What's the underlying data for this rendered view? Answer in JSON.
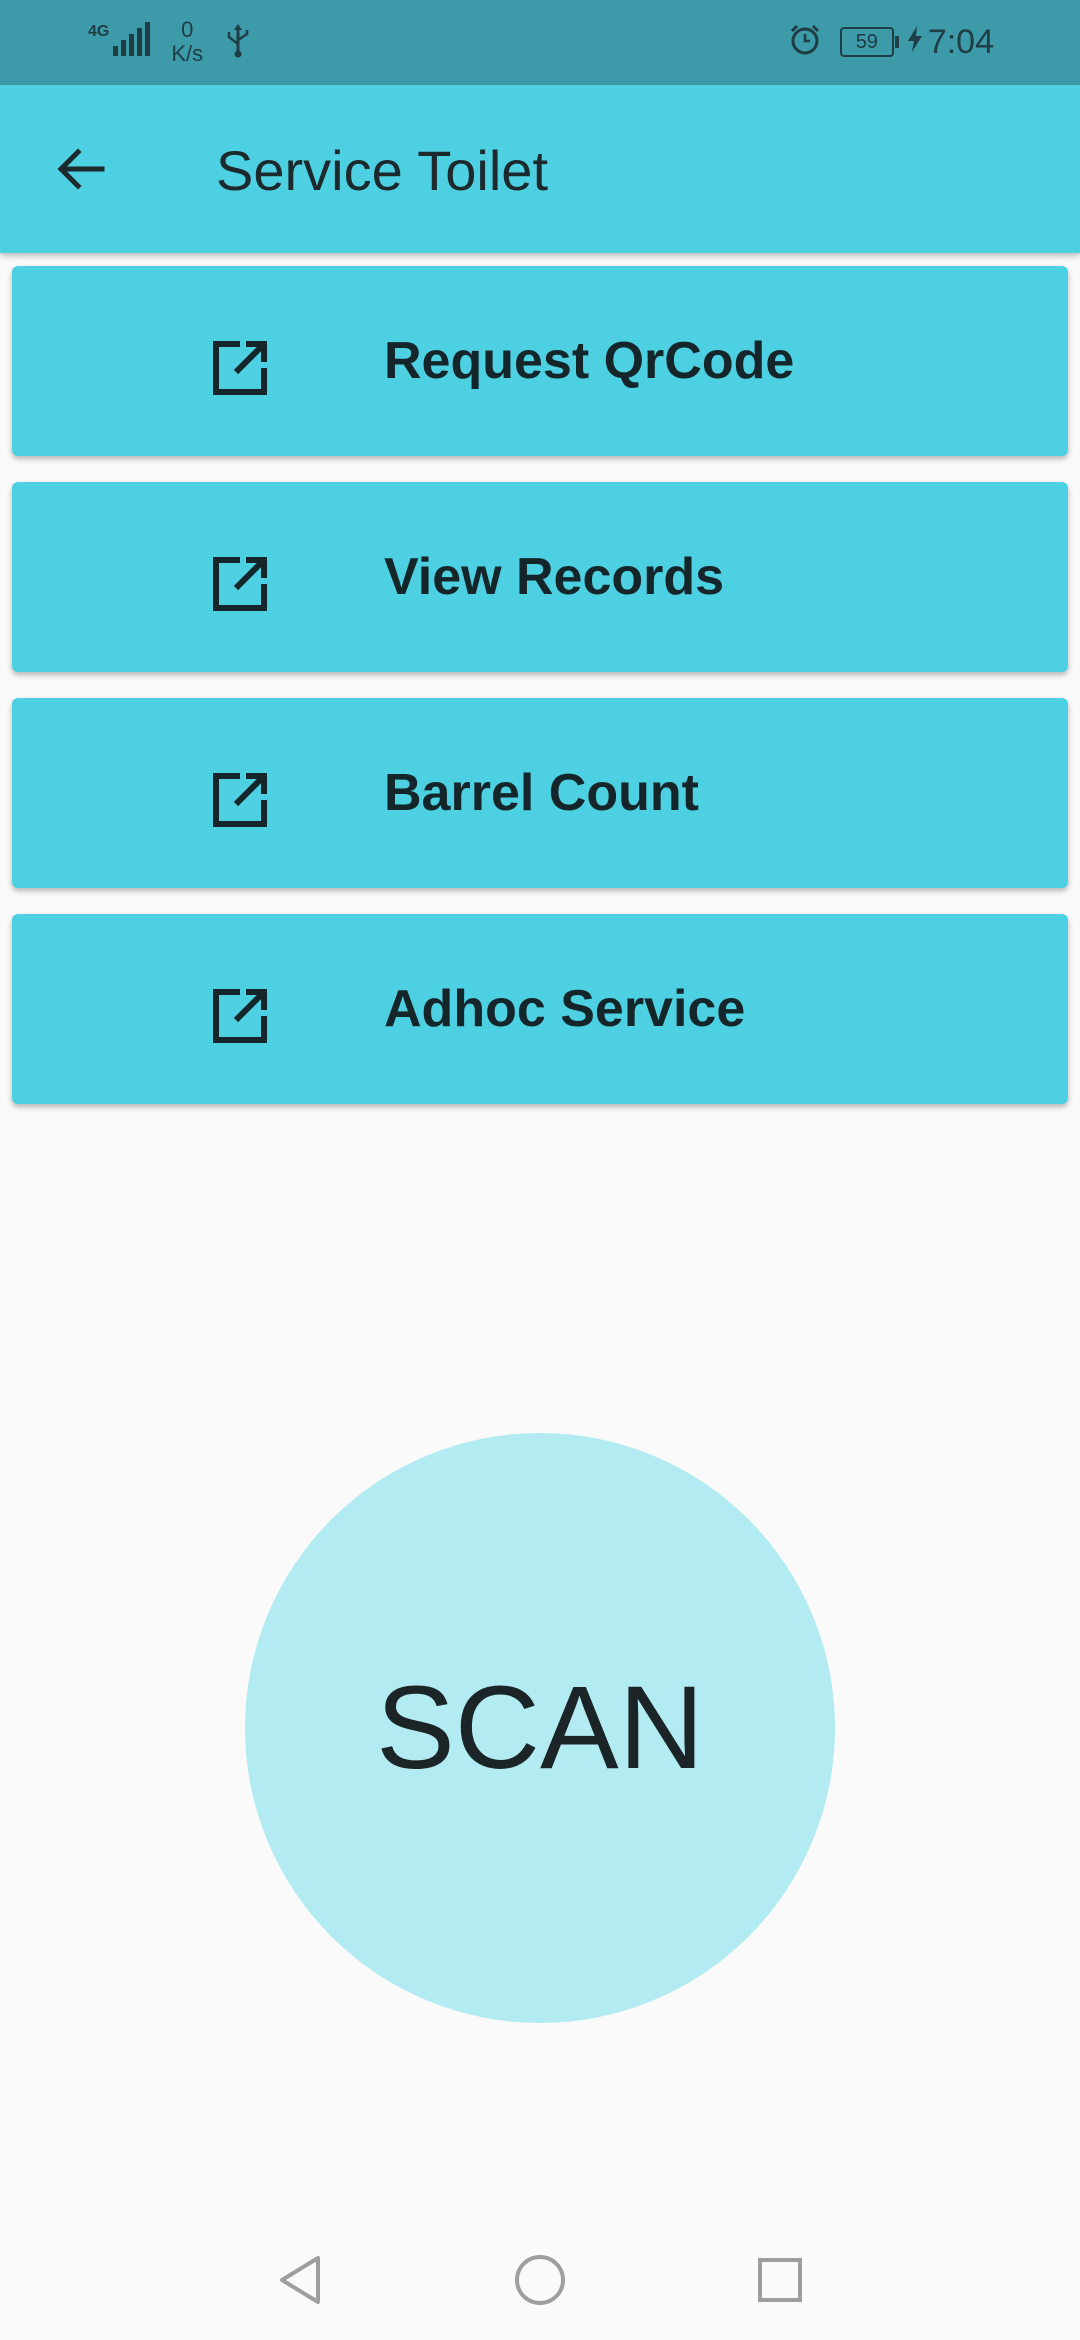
{
  "status_bar": {
    "network_type": "4G",
    "speed_value": "0",
    "speed_unit": "K/s",
    "battery": "59",
    "time": "7:04",
    "icons": [
      "signal-icon",
      "usb-icon",
      "alarm-icon",
      "battery-icon",
      "charging-icon"
    ]
  },
  "app_bar": {
    "title": "Service Toilet",
    "back_icon": "arrow-back-icon"
  },
  "menu": {
    "items": [
      {
        "label": "Request QrCode",
        "icon": "open-in-new-icon"
      },
      {
        "label": "View Records",
        "icon": "open-in-new-icon"
      },
      {
        "label": "Barrel Count",
        "icon": "open-in-new-icon"
      },
      {
        "label": "Adhoc Service",
        "icon": "open-in-new-icon"
      }
    ]
  },
  "scan": {
    "label": "SCAN"
  },
  "nav_bar": {
    "items": [
      "back-triangle-icon",
      "home-circle-icon",
      "recents-square-icon"
    ]
  },
  "colors": {
    "status_bar": "#3d9aa8",
    "primary": "#4dd0e1",
    "scan_circle": "#b2ebf2",
    "background": "#fafafa",
    "text_dark": "#15262b"
  }
}
